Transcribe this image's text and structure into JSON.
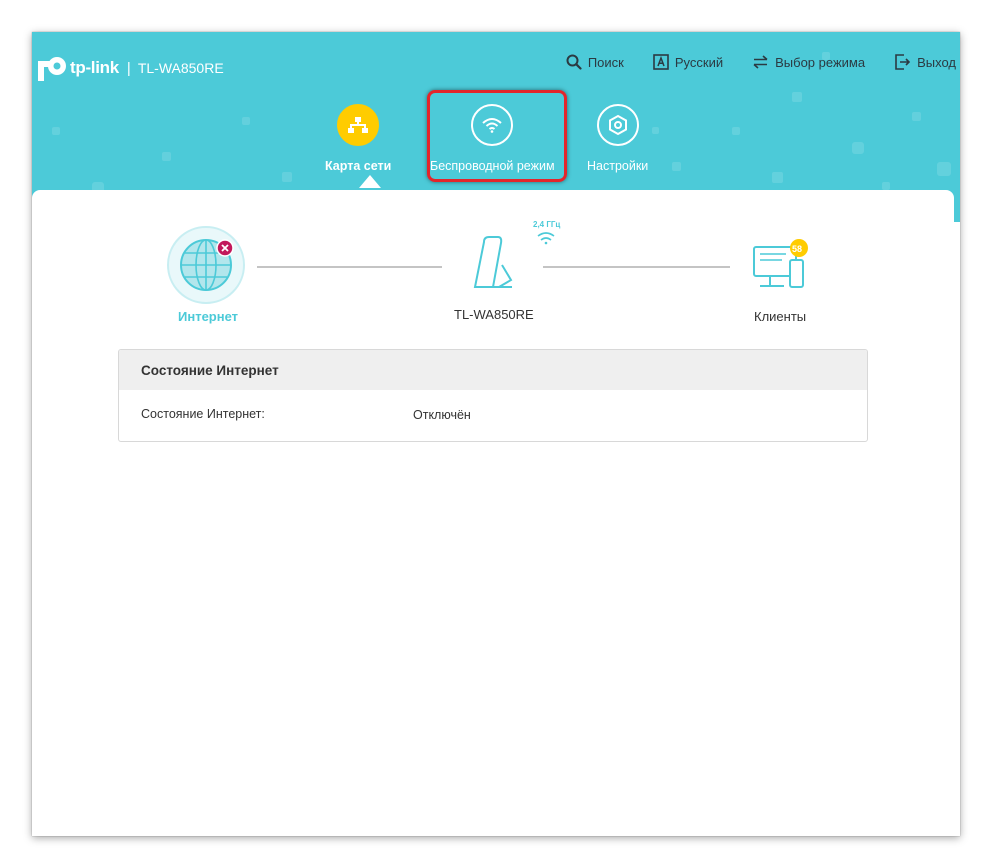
{
  "brand": {
    "logo_text": "tp-link",
    "separator": "|",
    "model": "TL-WA850RE"
  },
  "top_nav": [
    {
      "label": "Поиск",
      "icon": "search-icon"
    },
    {
      "label": "Русский",
      "icon": "language-icon"
    },
    {
      "label": "Выбор режима",
      "icon": "mode-switch-icon"
    },
    {
      "label": "Выход",
      "icon": "logout-icon"
    }
  ],
  "main_nav": [
    {
      "label": "Карта сети",
      "icon": "network-map-icon",
      "active": true
    },
    {
      "label": "Беспроводной режим",
      "icon": "wifi-icon",
      "active": false,
      "highlighted": true
    },
    {
      "label": "Настройки",
      "icon": "settings-icon",
      "active": false
    }
  ],
  "diagram": {
    "internet": {
      "label": "Интернет",
      "status": "disconnected"
    },
    "device": {
      "label": "TL-WA850RE",
      "band": "2,4 ГГц"
    },
    "clients": {
      "label": "Клиенты",
      "count": "58"
    }
  },
  "status_panel": {
    "title": "Состояние Интернет",
    "rows": [
      {
        "key": "Состояние Интернет:",
        "value": "Отключён"
      }
    ]
  },
  "colors": {
    "header": "#4ccad8",
    "accent": "#4ccad8",
    "active_tab": "#ffcc00",
    "highlight_box": "#e3252b",
    "error_badge": "#c2185b",
    "clients_badge": "#ffcc00"
  }
}
